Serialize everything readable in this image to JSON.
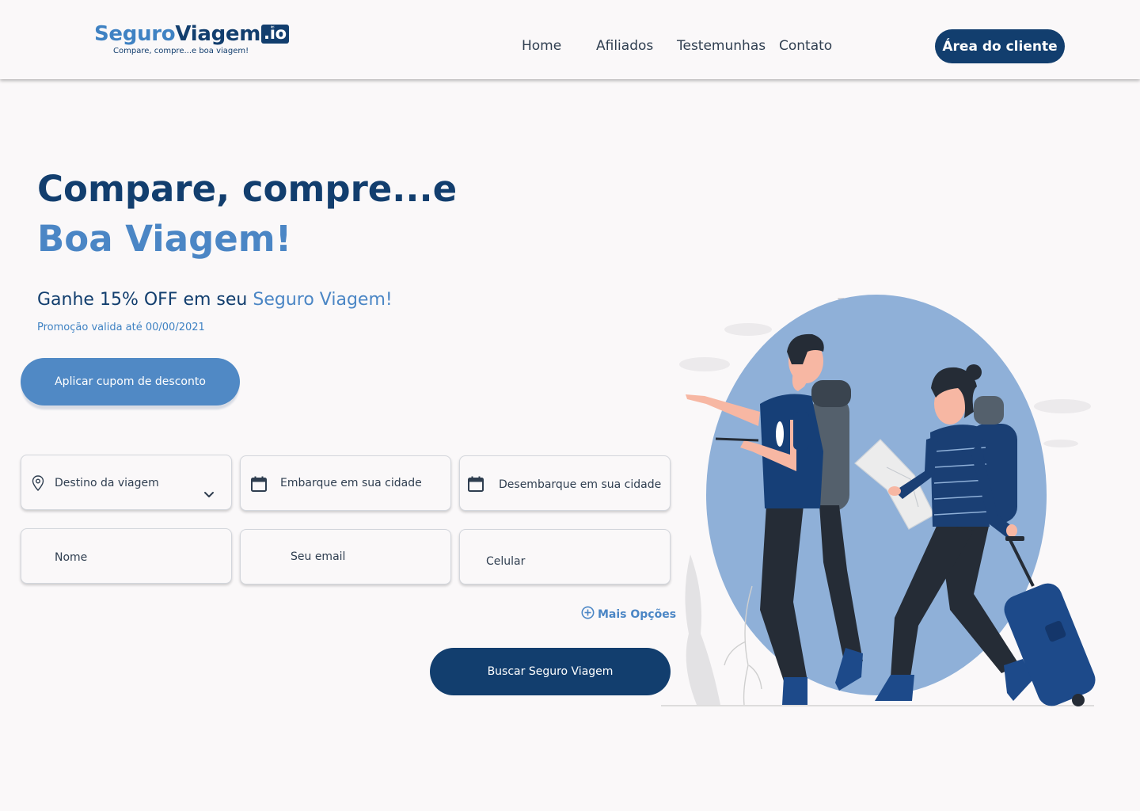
{
  "header": {
    "logo": {
      "part1": "Seguro",
      "part2": "Viagem",
      "part3": ".io",
      "registered": "®",
      "tagline": "Compare, compre...e boa viagem!"
    },
    "nav": [
      {
        "label": "Home"
      },
      {
        "label": "Afiliados"
      },
      {
        "label": "Testemunhas"
      },
      {
        "label": "Contato"
      }
    ],
    "cta_label": "Área do cliente"
  },
  "hero": {
    "headline_line1": "Compare, compre...e",
    "headline_line2": "Boa Viagem!",
    "offer_prefix": "Ganhe 15% OFF em seu ",
    "offer_accent": "Seguro Viagem!",
    "promo_note": "Promoção valida até 00/00/2021",
    "coupon_button": "Aplicar cupom de desconto"
  },
  "form": {
    "destination": {
      "label": "Destino da viagem",
      "icon": "location-pin-icon",
      "chevron": "chevron-down-icon"
    },
    "departure": {
      "label": "Embarque em sua cidade",
      "icon": "calendar-icon"
    },
    "arrival": {
      "label": "Desembarque em sua cidade",
      "icon": "calendar-icon"
    },
    "name": {
      "placeholder": "Nome"
    },
    "email": {
      "placeholder": "Seu email"
    },
    "phone": {
      "placeholder": "Celular"
    },
    "more_options": "Mais Opções",
    "search_button": "Buscar Seguro Viagem"
  },
  "colors": {
    "primary": "#123e6e",
    "accent": "#4b86c5",
    "coupon": "#5089c5",
    "background": "#faf8f9"
  }
}
